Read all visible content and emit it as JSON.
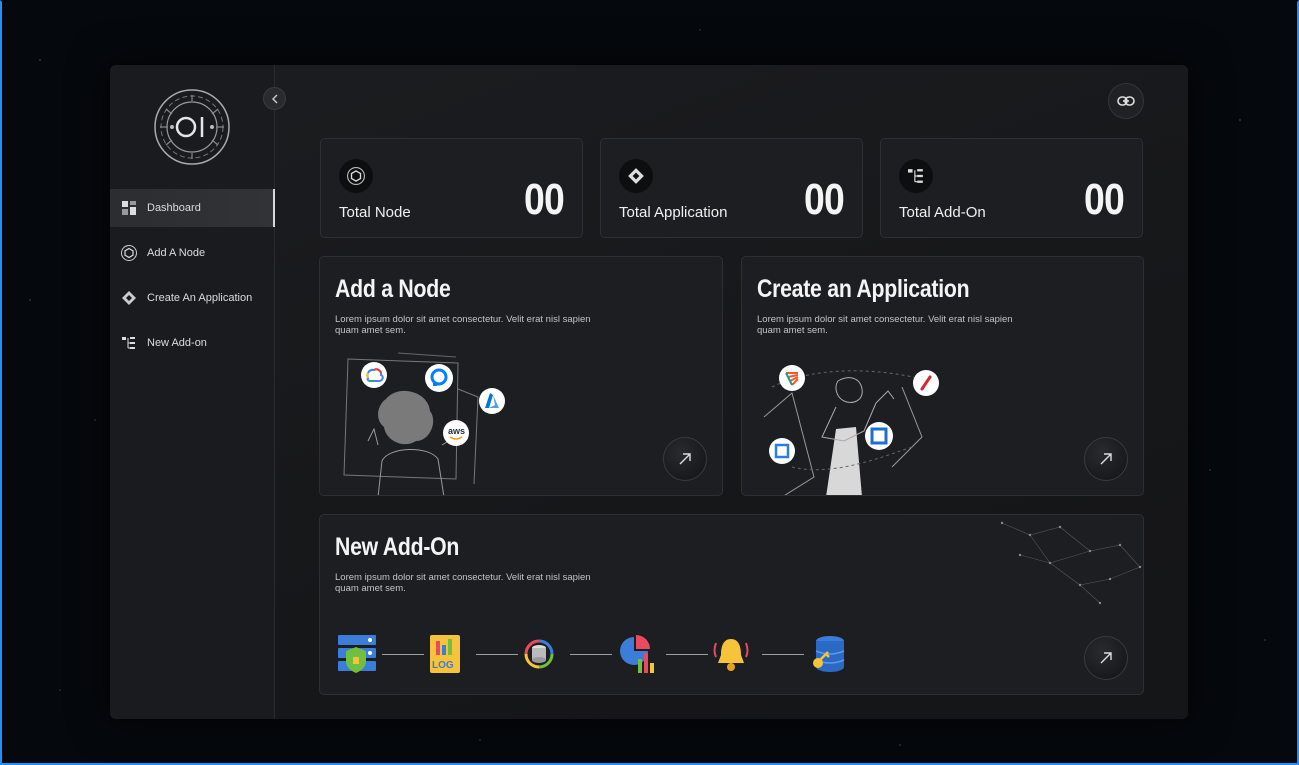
{
  "sidebar": {
    "collapse_icon": "chevron-left-icon",
    "items": [
      {
        "label": "Dashboard",
        "icon": "grid-icon",
        "active": true
      },
      {
        "label": "Add A Node",
        "icon": "node-hexagon-icon",
        "active": false
      },
      {
        "label": "Create An Application",
        "icon": "application-diamond-icon",
        "active": false
      },
      {
        "label": "New Add-on",
        "icon": "addon-tree-icon",
        "active": false
      }
    ]
  },
  "header": {
    "link_icon": "link-icon"
  },
  "stats": [
    {
      "label": "Total Node",
      "value": "00",
      "icon": "node-hexagon-icon"
    },
    {
      "label": "Total Application",
      "value": "00",
      "icon": "application-diamond-icon"
    },
    {
      "label": "Total Add-On",
      "value": "00",
      "icon": "addon-tree-icon"
    }
  ],
  "cards": {
    "node": {
      "title": "Add a Node",
      "description": "Lorem ipsum dolor sit amet consectetur. Velit erat nisl sapien quam amet sem.",
      "aws_label": "aws"
    },
    "application": {
      "title": "Create an Application",
      "description": "Lorem ipsum dolor sit amet consectetur. Velit erat nisl sapien quam amet sem."
    },
    "addon": {
      "title": "New Add-On",
      "description": "Lorem ipsum dolor sit amet consectetur. Velit erat nisl sapien quam amet sem.",
      "log_label": "LOG"
    }
  },
  "colors": {
    "accent": "#f4f4f4",
    "panel": "#1d1e21",
    "frame": "#1e90ff"
  }
}
